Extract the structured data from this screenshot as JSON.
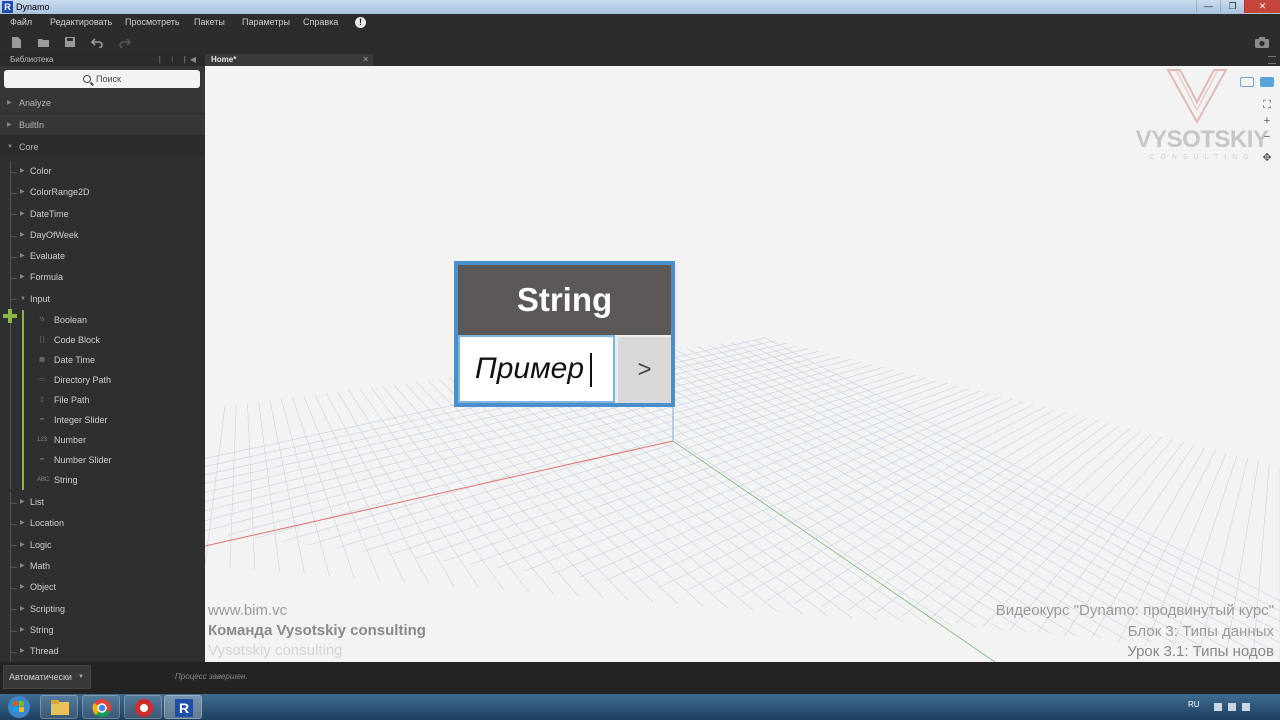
{
  "window": {
    "title": "Dynamo",
    "app_icon_letter": "R",
    "controls": [
      "—",
      "❐",
      "✕"
    ]
  },
  "menu": {
    "items": [
      "Файл",
      "Редактировать",
      "Просмотреть",
      "Пакеты",
      "Параметры",
      "Справка"
    ],
    "info_icon": "!"
  },
  "toolbar": {
    "icons": [
      "new-file-icon",
      "open-icon",
      "save-icon",
      "undo-icon",
      "redo-icon"
    ],
    "camera_icon": "camera-icon"
  },
  "library": {
    "header": "Библиотека",
    "search_placeholder": "Поиск",
    "top_categories": [
      "Analyze",
      "BuiltIn"
    ],
    "open_category": "Core",
    "core_items_before": [
      "Color",
      "ColorRange2D",
      "DateTime",
      "DayOfWeek",
      "Evaluate",
      "Formula"
    ],
    "input_label": "Input",
    "input_items": [
      {
        "label": "Boolean",
        "icon": "½"
      },
      {
        "label": "Code Block",
        "icon": "[ ]"
      },
      {
        "label": "Date Time",
        "icon": "▦"
      },
      {
        "label": "Directory Path",
        "icon": "▭"
      },
      {
        "label": "File Path",
        "icon": "▯"
      },
      {
        "label": "Integer Slider",
        "icon": "━"
      },
      {
        "label": "Number",
        "icon": "123"
      },
      {
        "label": "Number Slider",
        "icon": "━"
      },
      {
        "label": "String",
        "icon": "ABC"
      }
    ],
    "core_items_after": [
      "List",
      "Location",
      "Logic",
      "Math",
      "Object",
      "Scripting",
      "String",
      "Thread"
    ]
  },
  "tabs": {
    "home": "Home*"
  },
  "node": {
    "title": "String",
    "value": "Пример",
    "output_port": ">"
  },
  "logo": {
    "brand": "VYSOTSKIY",
    "sub": "CONSULTING"
  },
  "watermark": {
    "site": "www.bim.vc",
    "team": "Команда Vysotskiy consulting",
    "vc": "Vysotskiy consulting",
    "course": "Видеокурс \"Dynamo: продвинутый курс\"",
    "block": "Блок 3: Типы данных",
    "lesson": "Урок 3.1: Типы нодов"
  },
  "status": {
    "run_mode": "Автоматически",
    "message": "Процесс завершен."
  },
  "taskbar": {
    "language": "RU"
  },
  "colors": {
    "node_border": "#4a8fcc",
    "node_header": "#5b5857",
    "accent_green": "#8ab646",
    "axis_red": "#e07070",
    "axis_green": "#8fc08f"
  }
}
